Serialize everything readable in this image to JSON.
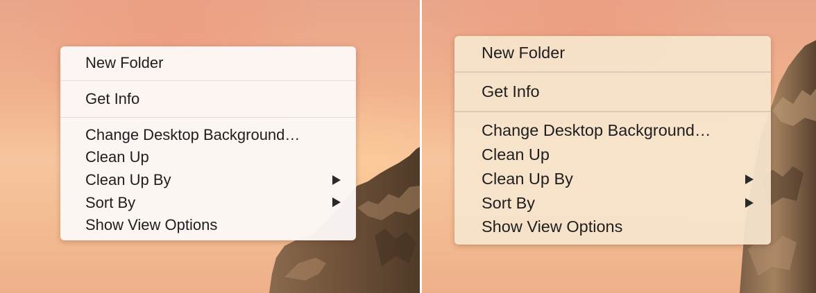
{
  "menus": [
    {
      "items": [
        {
          "label": "New Folder",
          "submenu": false
        },
        {
          "label": "Get Info",
          "submenu": false
        },
        {
          "label": "Change Desktop Background…",
          "submenu": false
        },
        {
          "label": "Clean Up",
          "submenu": false
        },
        {
          "label": "Clean Up By",
          "submenu": true
        },
        {
          "label": "Sort By",
          "submenu": true
        },
        {
          "label": "Show View Options",
          "submenu": false
        }
      ]
    },
    {
      "items": [
        {
          "label": "New Folder",
          "submenu": false
        },
        {
          "label": "Get Info",
          "submenu": false
        },
        {
          "label": "Change Desktop Background…",
          "submenu": false
        },
        {
          "label": "Clean Up",
          "submenu": false
        },
        {
          "label": "Clean Up By",
          "submenu": true
        },
        {
          "label": "Sort By",
          "submenu": true
        },
        {
          "label": "Show View Options",
          "submenu": false
        }
      ]
    }
  ],
  "icons": {
    "submenu_arrow": "triangle-right-icon"
  }
}
